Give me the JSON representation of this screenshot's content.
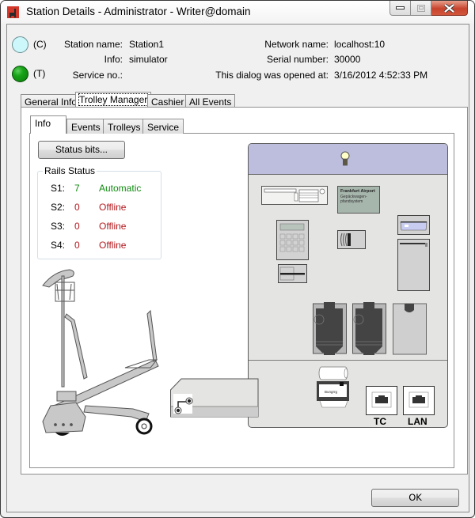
{
  "window": {
    "title": "Station Details - Administrator - Writer@domain",
    "controls": {
      "minimize": "minimize",
      "maximize": "maximize",
      "close": "close"
    }
  },
  "header": {
    "indicators": [
      {
        "label": "(C)",
        "state": "idle",
        "color": "#ccf7fb"
      },
      {
        "label": "(T)",
        "state": "ok",
        "color": "#18a418"
      }
    ],
    "fields_left": [
      {
        "label": "Station name:",
        "value": "Station1"
      },
      {
        "label": "Info:",
        "value": "simulator"
      },
      {
        "label": "Service no.:",
        "value": ""
      }
    ],
    "fields_right": [
      {
        "label": "Network name:",
        "value": "localhost:10"
      },
      {
        "label": "Serial number:",
        "value": "30000"
      },
      {
        "label": "This dialog was opened at:",
        "value": "3/16/2012 4:52:33 PM"
      }
    ]
  },
  "outer_tabs": [
    {
      "label": "General Info",
      "selected": false
    },
    {
      "label": "Trolley Manager",
      "selected": true
    },
    {
      "label": "Cashier",
      "selected": false
    },
    {
      "label": "All Events",
      "selected": false
    }
  ],
  "inner_tabs": [
    {
      "label": "Info",
      "selected": true
    },
    {
      "label": "Events",
      "selected": false
    },
    {
      "label": "Trolleys",
      "selected": false
    },
    {
      "label": "Service",
      "selected": false
    }
  ],
  "info": {
    "status_bits_button": "Status bits...",
    "rails_status": {
      "title": "Rails Status",
      "rows": [
        {
          "name": "S1:",
          "count": "7",
          "status": "Automatic",
          "status_color": "#108a10"
        },
        {
          "name": "S2:",
          "count": "0",
          "status": "Offline",
          "status_color": "#b3181d"
        },
        {
          "name": "S3:",
          "count": "0",
          "status": "Offline",
          "status_color": "#b3181d"
        },
        {
          "name": "S4:",
          "count": "0",
          "status": "Offline",
          "status_color": "#b3181d"
        }
      ]
    },
    "kiosk": {
      "sign_title": "Frankfurt Airport",
      "sign_line1": "Gepäckwagen-",
      "sign_line2": "pfandsystem",
      "receipt_label": "Bungrrg",
      "port_tc": "TC",
      "port_lan": "LAN"
    }
  },
  "footer": {
    "ok_button": "OK"
  }
}
